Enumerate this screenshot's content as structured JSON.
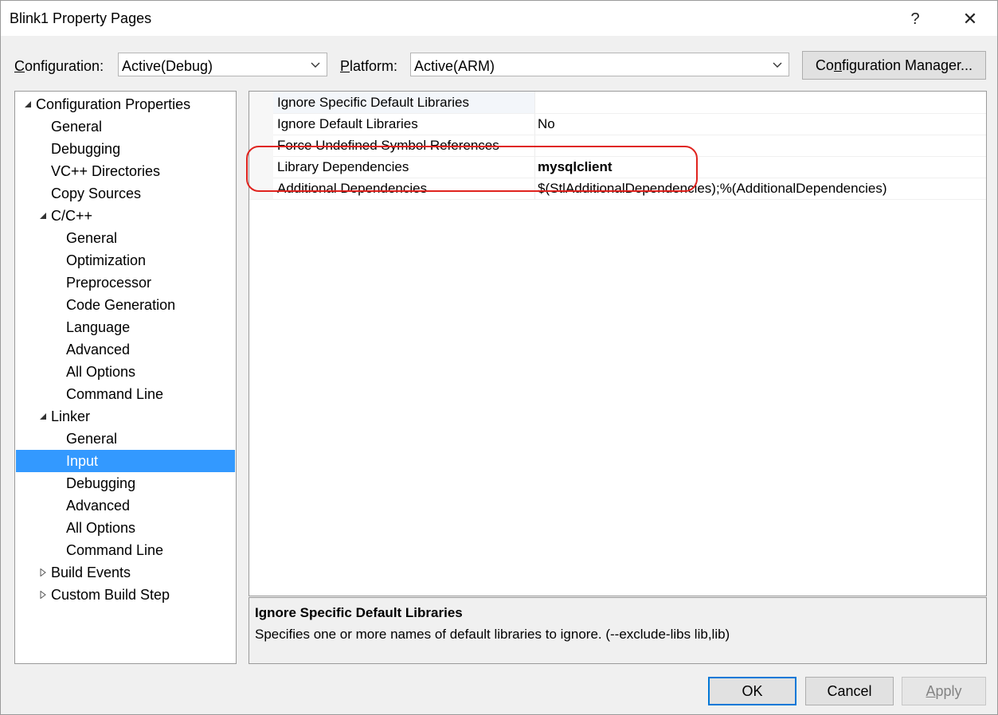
{
  "window": {
    "title": "Blink1 Property Pages",
    "help_glyph": "?",
    "close_glyph": "✕"
  },
  "toolbar": {
    "configuration_label": "Configuration:",
    "configuration_value": "Active(Debug)",
    "platform_label": "Platform:",
    "platform_value": "Active(ARM)",
    "config_manager_label": "Configuration Manager..."
  },
  "tree": {
    "items": [
      {
        "label": "Configuration Properties",
        "level": 0,
        "expander": "expanded"
      },
      {
        "label": "General",
        "level": 1,
        "expander": "none"
      },
      {
        "label": "Debugging",
        "level": 1,
        "expander": "none"
      },
      {
        "label": "VC++ Directories",
        "level": 1,
        "expander": "none"
      },
      {
        "label": "Copy Sources",
        "level": 1,
        "expander": "none"
      },
      {
        "label": "C/C++",
        "level": 1,
        "expander": "expanded"
      },
      {
        "label": "General",
        "level": 2,
        "expander": "none"
      },
      {
        "label": "Optimization",
        "level": 2,
        "expander": "none"
      },
      {
        "label": "Preprocessor",
        "level": 2,
        "expander": "none"
      },
      {
        "label": "Code Generation",
        "level": 2,
        "expander": "none"
      },
      {
        "label": "Language",
        "level": 2,
        "expander": "none"
      },
      {
        "label": "Advanced",
        "level": 2,
        "expander": "none"
      },
      {
        "label": "All Options",
        "level": 2,
        "expander": "none"
      },
      {
        "label": "Command Line",
        "level": 2,
        "expander": "none"
      },
      {
        "label": "Linker",
        "level": 1,
        "expander": "expanded"
      },
      {
        "label": "General",
        "level": 2,
        "expander": "none"
      },
      {
        "label": "Input",
        "level": 2,
        "expander": "none",
        "selected": true
      },
      {
        "label": "Debugging",
        "level": 2,
        "expander": "none"
      },
      {
        "label": "Advanced",
        "level": 2,
        "expander": "none"
      },
      {
        "label": "All Options",
        "level": 2,
        "expander": "none"
      },
      {
        "label": "Command Line",
        "level": 2,
        "expander": "none"
      },
      {
        "label": "Build Events",
        "level": 1,
        "expander": "collapsed"
      },
      {
        "label": "Custom Build Step",
        "level": 1,
        "expander": "collapsed"
      }
    ]
  },
  "properties": {
    "rows": [
      {
        "name": "Ignore Specific Default Libraries",
        "value": ""
      },
      {
        "name": "Ignore Default Libraries",
        "value": "No"
      },
      {
        "name": "Force Undefined Symbol References",
        "value": ""
      },
      {
        "name": "Library Dependencies",
        "value": "mysqlclient",
        "bold": true
      },
      {
        "name": "Additional Dependencies",
        "value": "$(StlAdditionalDependencies);%(AdditionalDependencies)"
      }
    ]
  },
  "description": {
    "title": "Ignore Specific Default Libraries",
    "text": "Specifies one or more names of default libraries to ignore. (--exclude-libs lib,lib)"
  },
  "buttons": {
    "ok": "OK",
    "cancel": "Cancel",
    "apply": "Apply"
  },
  "colors": {
    "selection": "#3399ff",
    "highlight_annotation": "#e0231e",
    "default_button_border": "#0078d7"
  }
}
